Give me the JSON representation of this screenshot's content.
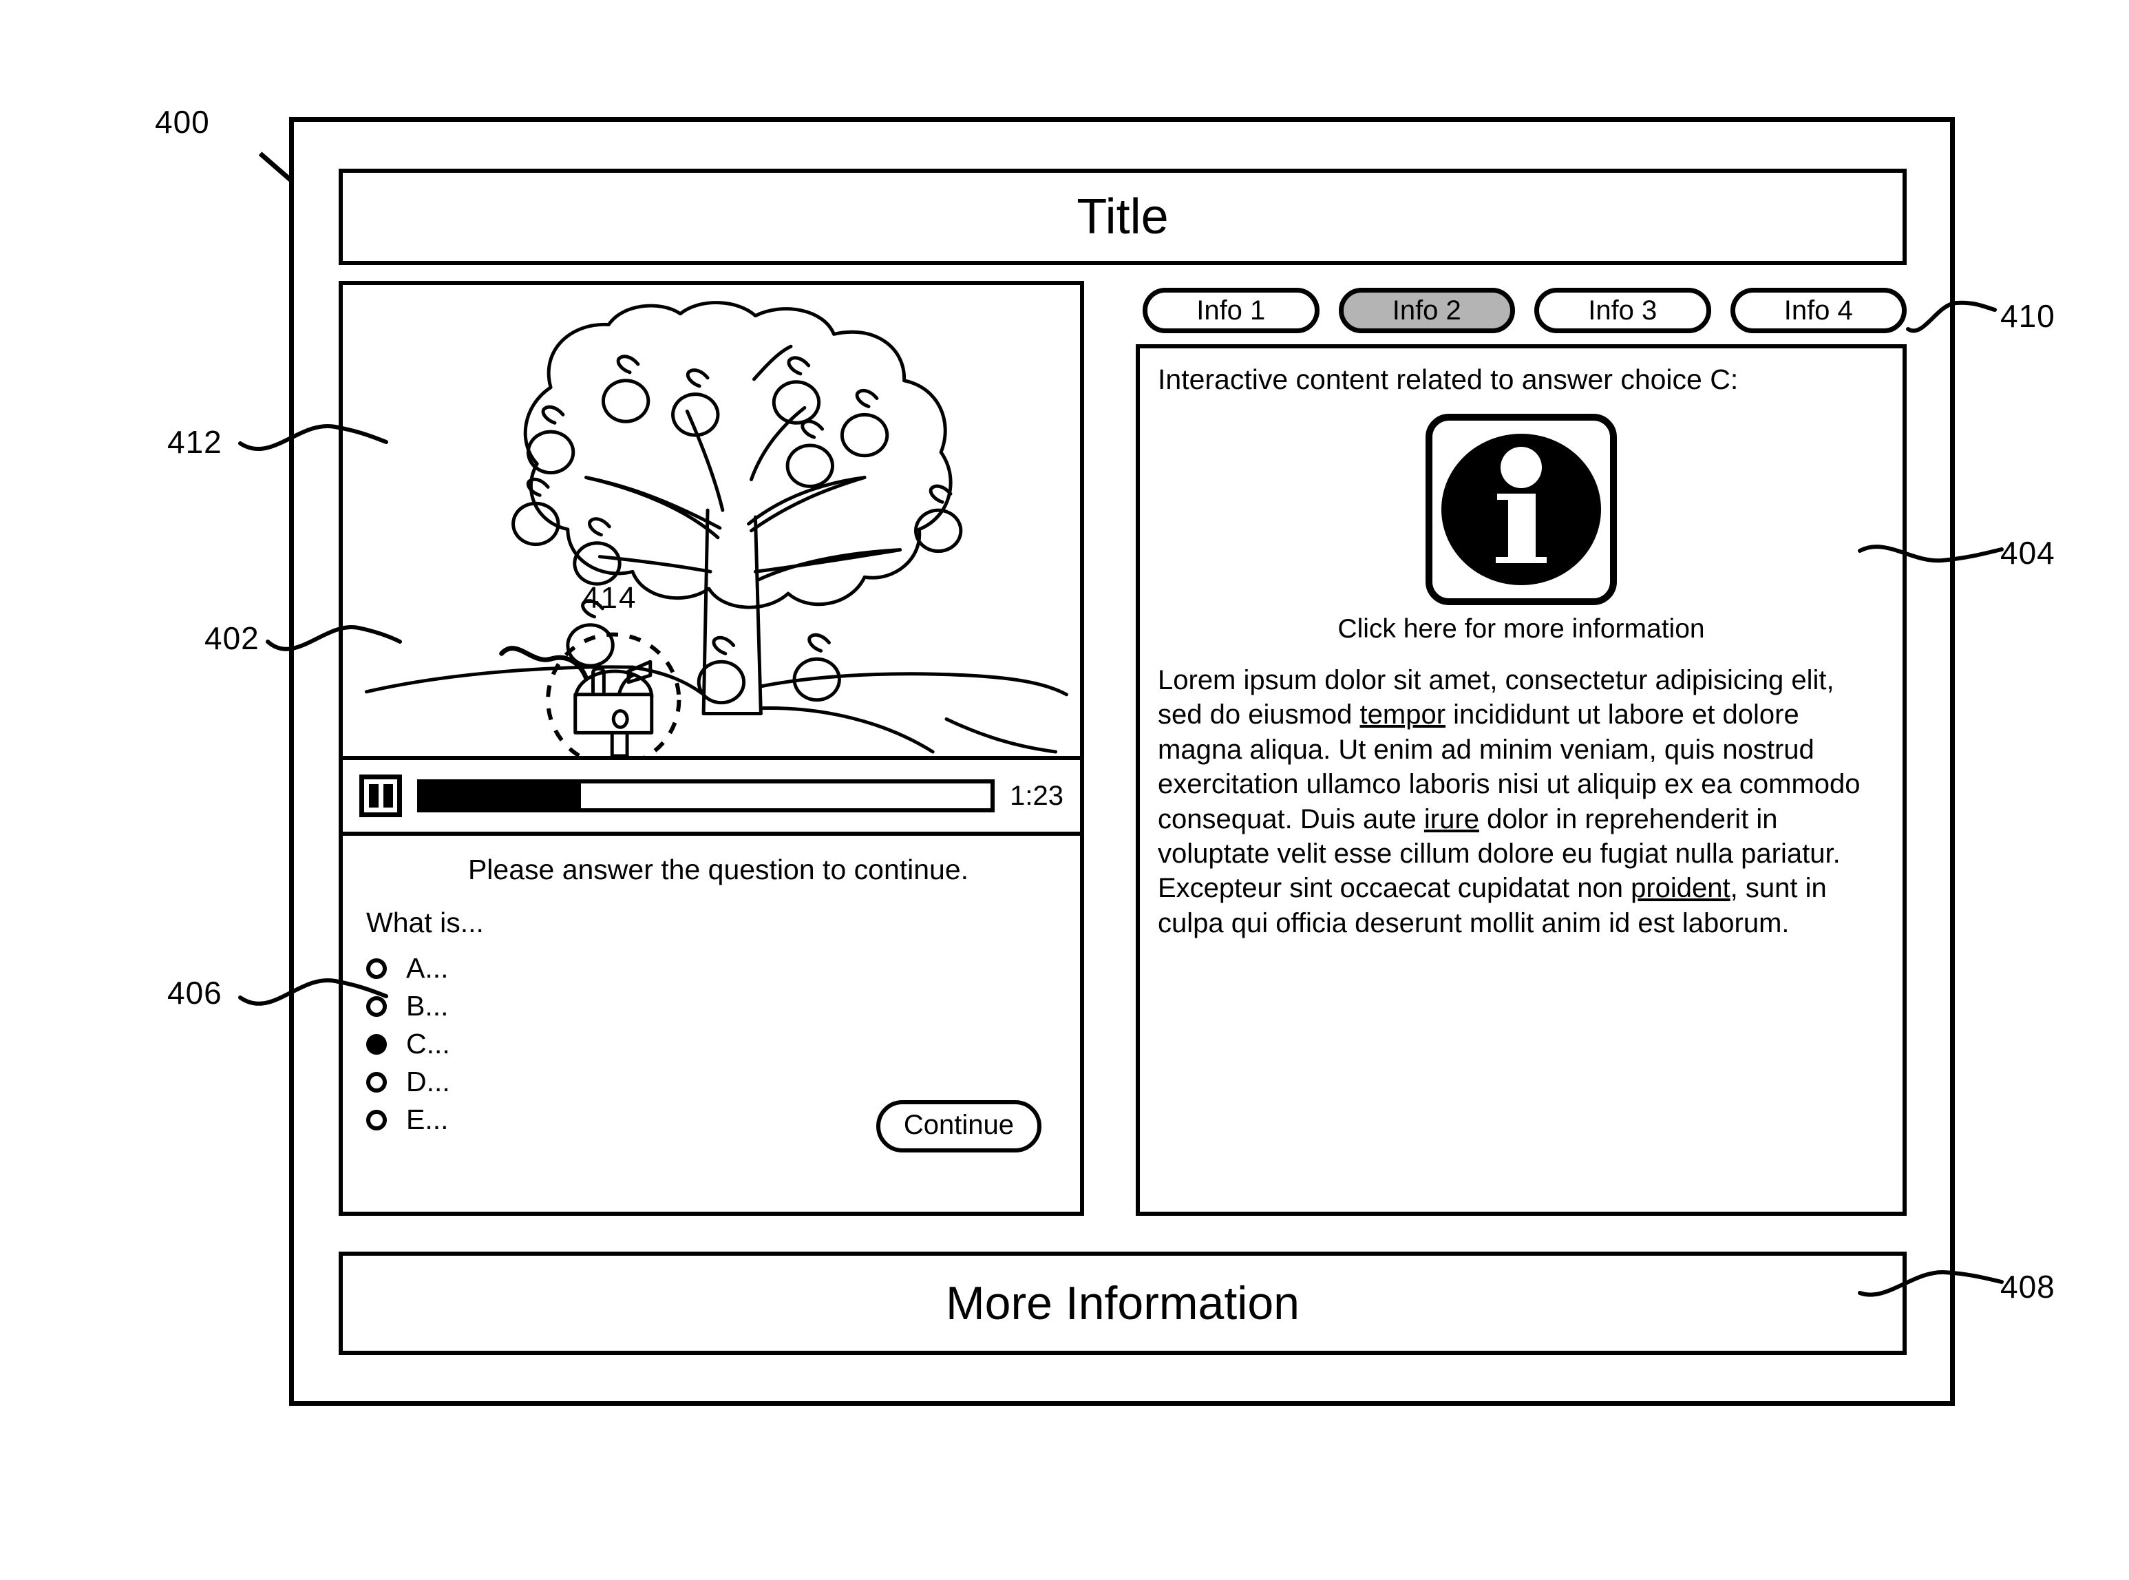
{
  "figure": {
    "main_ref": "400",
    "refs": {
      "device": "400",
      "media_player_controls": "402",
      "interactive_panel": "404",
      "question_area": "406",
      "footer": "408",
      "tab_row": "410",
      "video_stage": "412",
      "video_callout": "414"
    }
  },
  "header": {
    "title": "Title"
  },
  "video": {
    "callout_label": "414",
    "scene_icon": "apple-tree-with-mailbox-illustration"
  },
  "player": {
    "pause_icon": "pause-icon",
    "time": "1:23",
    "progress_percent": 28
  },
  "question": {
    "prompt": "Please answer the question to continue.",
    "stem": "What is...",
    "choices": [
      {
        "label": "A...",
        "selected": false
      },
      {
        "label": "B...",
        "selected": false
      },
      {
        "label": "C...",
        "selected": true
      },
      {
        "label": "D...",
        "selected": false
      },
      {
        "label": "E...",
        "selected": false
      }
    ],
    "continue_label": "Continue"
  },
  "tabs": [
    {
      "label": "Info 1",
      "active": false
    },
    {
      "label": "Info 2",
      "active": true
    },
    {
      "label": "Info 3",
      "active": false
    },
    {
      "label": "Info 4",
      "active": false
    }
  ],
  "interactive": {
    "heading": "Interactive content related to answer choice C:",
    "icon_name": "information-icon",
    "icon_glyph": "i",
    "caption": "Click here for more information",
    "body_segments": [
      {
        "text": "Lorem ipsum dolor sit amet, consectetur adipisicing elit, sed do eiusmod ",
        "link": false
      },
      {
        "text": "tempor",
        "link": true
      },
      {
        "text": " incididunt ut labore et dolore magna aliqua. Ut enim ad minim veniam, quis nostrud exercitation ullamco laboris nisi ut aliquip ex ea commodo consequat. Duis aute ",
        "link": false
      },
      {
        "text": "irure",
        "link": true
      },
      {
        "text": " dolor in reprehenderit in voluptate velit esse cillum dolore eu fugiat nulla pariatur. Excepteur sint occaecat cupidatat non ",
        "link": false
      },
      {
        "text": "proident",
        "link": true
      },
      {
        "text": ", sunt in culpa qui officia deserunt mollit anim id est laborum.",
        "link": false
      }
    ]
  },
  "footer": {
    "label": "More Information"
  },
  "colors": {
    "ink": "#000000",
    "paper": "#ffffff",
    "active_tab_fill": "#b4b4b4"
  }
}
